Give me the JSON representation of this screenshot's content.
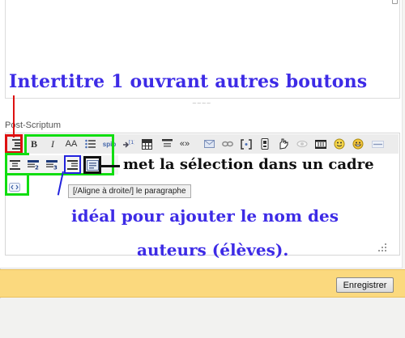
{
  "editor": {
    "field_label": "Post-Scriptum",
    "tooltip": "[/Aligne à droite/] le paragraphe",
    "grip": "~~~~",
    "toolbar_row1": [
      {
        "name": "heading-icon",
        "label": ""
      },
      {
        "name": "bold-button",
        "label": "B"
      },
      {
        "name": "italic-button",
        "label": "I"
      },
      {
        "name": "font-size-button",
        "label": "AA"
      },
      {
        "name": "list-icon",
        "label": ""
      },
      {
        "name": "spip-link-button",
        "label": "spip"
      },
      {
        "name": "footnote-button",
        "label": ""
      },
      {
        "name": "table-icon",
        "label": ""
      },
      {
        "name": "intertitle-icon",
        "label": ""
      },
      {
        "name": "quote-button",
        "label": "«»"
      },
      {
        "name": "envelope-icon",
        "label": ""
      },
      {
        "name": "link-chain-icon",
        "label": ""
      },
      {
        "name": "bracket-icon",
        "label": ""
      },
      {
        "name": "device-icon",
        "label": ""
      },
      {
        "name": "hand-icon",
        "label": ""
      },
      {
        "name": "eye-icon",
        "label": ""
      },
      {
        "name": "film-icon",
        "label": ""
      },
      {
        "name": "smiley-icon",
        "label": ""
      },
      {
        "name": "smiley-grin-icon",
        "label": ""
      },
      {
        "name": "separator-icon",
        "label": ""
      }
    ]
  },
  "annotations": {
    "intertitle": "Intertitre 1 ouvrant autres boutons",
    "frame": "met la sélection dans un cadre",
    "ideal_line1": "idéal pour ajouter le nom des",
    "ideal_line2": "auteurs (élèves)."
  },
  "footer": {
    "save_label": "Enregistrer"
  },
  "colors": {
    "annotation_blue": "#3d2be6",
    "highlight_green": "#11dd11",
    "highlight_red": "#dd1111",
    "footer_bar": "#fbd97e"
  }
}
